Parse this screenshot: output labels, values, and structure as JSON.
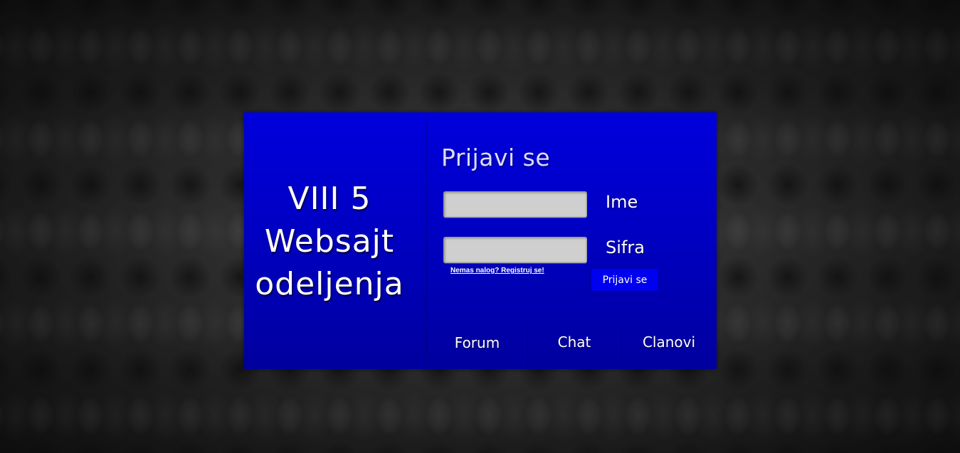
{
  "site": {
    "title_lines": [
      "VIII 5",
      "Websajt",
      "odeljenja"
    ]
  },
  "login": {
    "title": "Prijavi se",
    "username": {
      "label": "Ime",
      "value": "",
      "placeholder": ""
    },
    "password": {
      "label": "Sifra",
      "value": "",
      "placeholder": ""
    },
    "register_link": "Nemas nalog? Registruj se!",
    "submit_label": "Prijavi se"
  },
  "nav": {
    "items": [
      {
        "label": "Forum"
      },
      {
        "label": "Chat"
      },
      {
        "label": "Clanovi"
      }
    ]
  },
  "colors": {
    "panel": "#0000dc",
    "button": "#0000f0",
    "input": "#cfcfcf"
  }
}
